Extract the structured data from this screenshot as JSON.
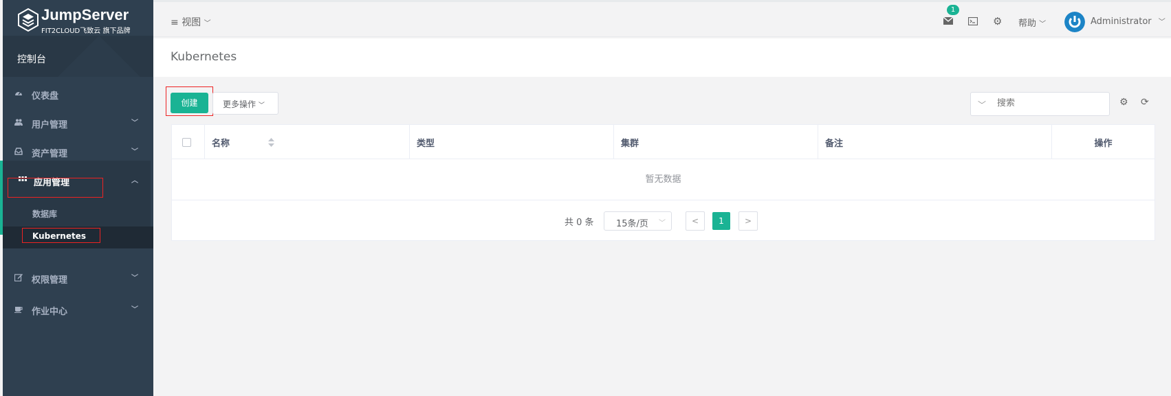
{
  "logo": {
    "title": "JumpServer",
    "subtitle": "FIT2CLOUD飞致云 旗下品牌"
  },
  "console": {
    "label": "控制台"
  },
  "sidebar": {
    "items": [
      {
        "label": "仪表盘",
        "icon": "dashboard-icon"
      },
      {
        "label": "用户管理",
        "icon": "users-icon"
      },
      {
        "label": "资产管理",
        "icon": "inbox-icon"
      },
      {
        "label": "应用管理",
        "icon": "grid-icon"
      },
      {
        "label": "权限管理",
        "icon": "edit-icon"
      },
      {
        "label": "作业中心",
        "icon": "coffee-icon"
      }
    ],
    "sub_items": [
      {
        "label": "数据库"
      },
      {
        "label": "Kubernetes"
      }
    ]
  },
  "topbar": {
    "view_label": "视图",
    "badge_count": "1",
    "help_label": "帮助",
    "user_name": "Administrator"
  },
  "page": {
    "title": "Kubernetes"
  },
  "toolbar": {
    "create_label": "创建",
    "more_label": "更多操作",
    "search_placeholder": "搜索"
  },
  "table": {
    "columns": [
      "名称",
      "类型",
      "集群",
      "备注",
      "操作"
    ],
    "empty_text": "暂无数据"
  },
  "pagination": {
    "total_text": "共 0 条",
    "page_size": "15条/页",
    "current_page": "1"
  },
  "colors": {
    "accent": "#1ab394",
    "sidebar": "#2f4050"
  }
}
